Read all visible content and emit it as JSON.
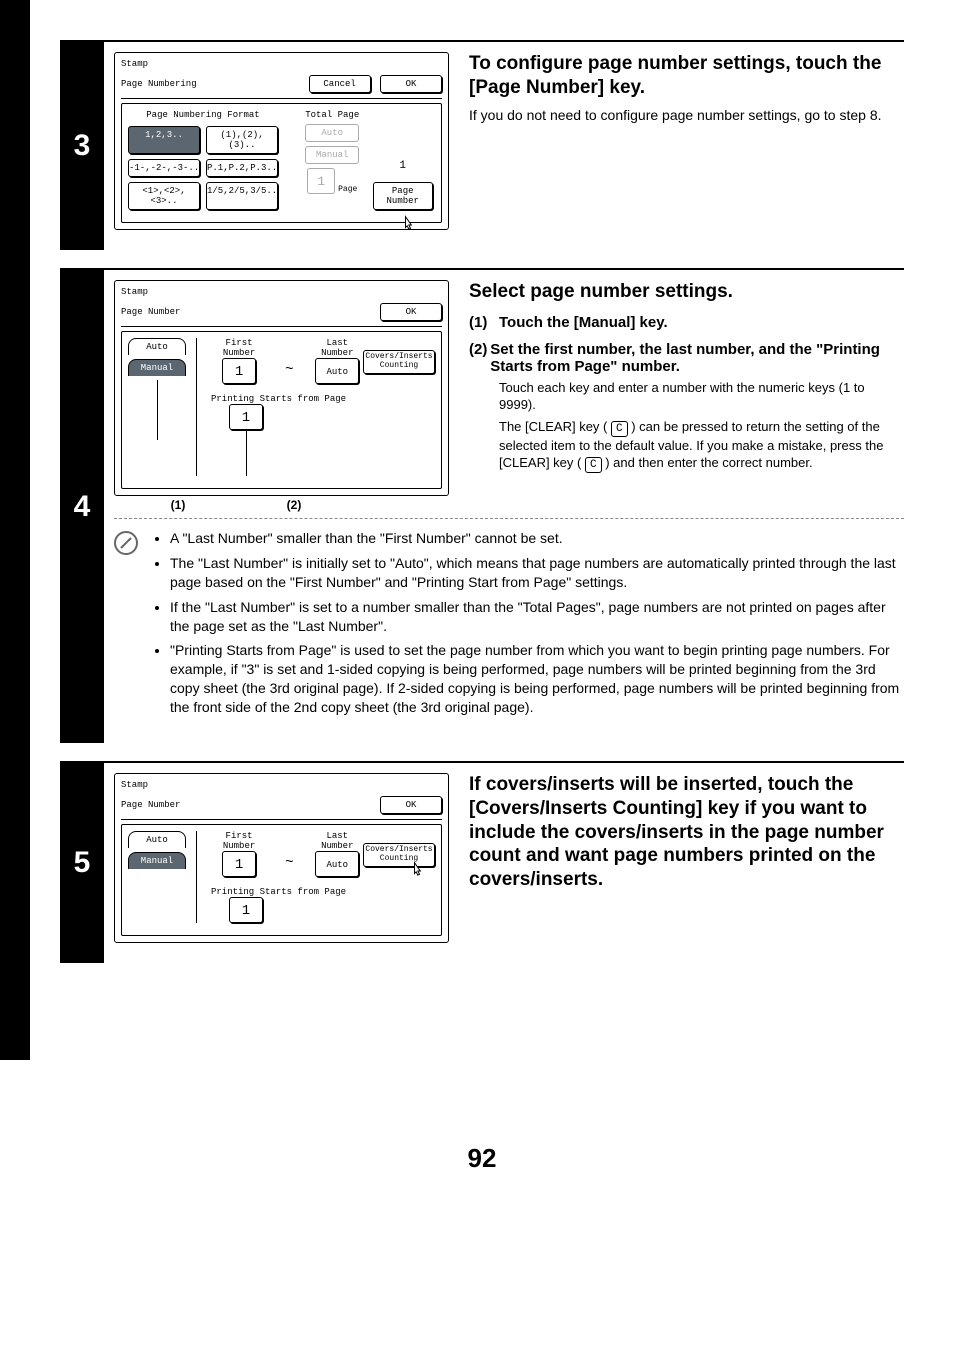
{
  "step3": {
    "number": "3",
    "dialog": {
      "title": "Stamp",
      "subtitle": "Page Numbering",
      "cancel": "Cancel",
      "ok": "OK",
      "format_label": "Page Numbering Format",
      "buttons": {
        "b1": "1,2,3..",
        "b2": "(1),(2),(3)..",
        "b3": "-1-,-2-,-3-..",
        "b4": "P.1,P.2,P.3..",
        "b5": "<1>,<2>,<3>..",
        "b6": "1/5,2/5,3/5.."
      },
      "total_page": "Total Page",
      "auto": "Auto",
      "manual": "Manual",
      "one": "1",
      "page_label": "Page",
      "page_number_btn": "Page Number",
      "right_one": "1"
    },
    "heading": "To configure page number settings, touch the [Page Number] key.",
    "text": "If you do not need to configure page number settings, go to step 8."
  },
  "step4": {
    "number": "4",
    "dialog": {
      "title": "Stamp",
      "subtitle": "Page Number",
      "ok": "OK",
      "auto": "Auto",
      "manual": "Manual",
      "first_number": "First Number",
      "last_number": "Last Number",
      "first_val": "1",
      "tilde": "~",
      "auto_btn": "Auto",
      "covers": "Covers/Inserts Counting",
      "psfp": "Printing Starts from Page",
      "psfp_val": "1",
      "mark1": "(1)",
      "mark2": "(2)"
    },
    "heading": "Select page number settings.",
    "sub1_num": "(1)",
    "sub1_text": "Touch the [Manual] key.",
    "sub2_num": "(2)",
    "sub2_text": "Set the first number, the last number, and the \"Printing Starts from Page\" number.",
    "detail1": "Touch each key and enter a number with the numeric keys (1 to 9999).",
    "detail2a": "The [CLEAR] key (",
    "clear_c": "C",
    "detail2b": ") can be pressed to return the setting of the selected item to the default value. If you make a mistake, press the [CLEAR] key (",
    "detail2c": ") and then enter the correct number.",
    "notes": {
      "n1": "A \"Last Number\" smaller than the \"First Number\" cannot be set.",
      "n2": "The \"Last Number\" is initially set to \"Auto\", which means that page numbers are automatically printed through the last page based on the \"First Number\" and \"Printing Start from Page\" settings.",
      "n3": "If the \"Last Number\" is set to a number smaller than the \"Total Pages\", page numbers are not printed on pages after the page set as the \"Last Number\".",
      "n4": "\"Printing Starts from Page\" is used to set the page number from which you want to begin printing page numbers. For example, if \"3\" is set and 1-sided copying is being performed, page numbers will be printed beginning from the 3rd copy sheet (the 3rd original page). If 2-sided copying is being performed, page numbers will be printed beginning from the front side of the 2nd copy sheet (the 3rd original page)."
    }
  },
  "step5": {
    "number": "5",
    "dialog": {
      "title": "Stamp",
      "subtitle": "Page Number",
      "ok": "OK",
      "auto": "Auto",
      "manual": "Manual",
      "first_number": "First Number",
      "last_number": "Last Number",
      "first_val": "1",
      "tilde": "~",
      "auto_btn": "Auto",
      "covers": "Covers/Inserts Counting",
      "psfp": "Printing Starts from Page",
      "psfp_val": "1"
    },
    "heading": "If covers/inserts will be inserted, touch the [Covers/Inserts Counting] key if you want to include the covers/inserts in the page number count and want page numbers printed on the covers/inserts."
  },
  "page_number": "92"
}
